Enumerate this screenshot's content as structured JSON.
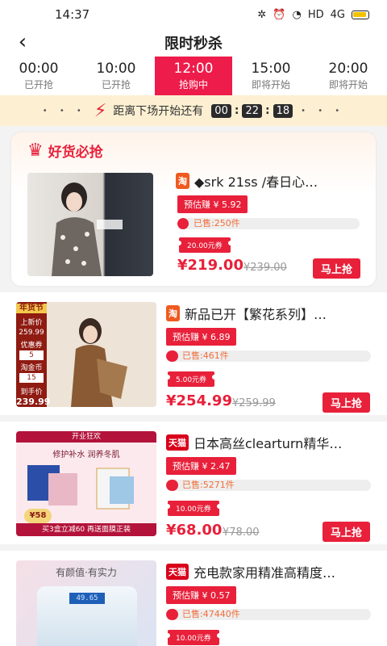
{
  "status": {
    "time": "14:37",
    "network": "HD",
    "signal_label": "4G"
  },
  "nav": {
    "title": "限时秒杀",
    "back_icon": "back-arrow-icon"
  },
  "time_slots": [
    {
      "time": "00:00",
      "status": "已开抢"
    },
    {
      "time": "10:00",
      "status": "已开抢"
    },
    {
      "time": "12:00",
      "status": "抢购中",
      "active": true
    },
    {
      "time": "15:00",
      "status": "即将开始"
    },
    {
      "time": "20:00",
      "status": "即将开始"
    }
  ],
  "countdown": {
    "label": "距离下场开始还有",
    "hours": "00",
    "minutes": "22",
    "seconds": "18"
  },
  "featured": {
    "title": "好货必抢"
  },
  "products": [
    {
      "shop": "淘",
      "title": "◆srk 21ss /春日心…",
      "earn": "预估赚 ¥ 5.92",
      "sold": "已售:250件",
      "sold_ratio": 0.06,
      "coupon": "20.00元券",
      "price": "¥219.00",
      "orig_price": "¥239.00",
      "buy": "马上抢"
    },
    {
      "shop": "淘",
      "title": "新品已开【繁花系列】…",
      "earn": "预估赚 ¥ 6.89",
      "sold": "已售:461件",
      "sold_ratio": 0.06,
      "coupon": "5.00元券",
      "price": "¥254.99",
      "orig_price": "¥259.99",
      "buy": "马上抢",
      "promo": {
        "top": "年货节",
        "l1": "上新价",
        "p1": "259.99",
        "l2": "优惠券",
        "p2": "5",
        "l3": "淘金币",
        "p3": "15",
        "l4": "到手价",
        "p4": "239.99"
      }
    },
    {
      "shop": "天猫",
      "title": "日本高丝clearturn精华…",
      "earn": "预估赚 ¥ 2.47",
      "sold": "已售:5271件",
      "sold_ratio": 0.06,
      "coupon": "10.00元券",
      "price": "¥68.00",
      "orig_price": "¥78.00",
      "buy": "马上抢",
      "promo": {
        "banner": "开业狂欢",
        "line": "修护补水 润养冬肌",
        "badge": "¥58",
        "bottom": "买3盒立减60 再送面膜正装"
      }
    },
    {
      "shop": "天猫",
      "title": "充电款家用精准高精度…",
      "earn": "预估赚 ¥ 0.57",
      "sold": "已售:47440件",
      "sold_ratio": 0.06,
      "coupon": "10.00元券",
      "promo": {
        "line": "有颜值·有实力",
        "display": "49.65"
      }
    }
  ],
  "colors": {
    "accent": "#e8203a",
    "countdown_bg": "#fdf0d2"
  }
}
